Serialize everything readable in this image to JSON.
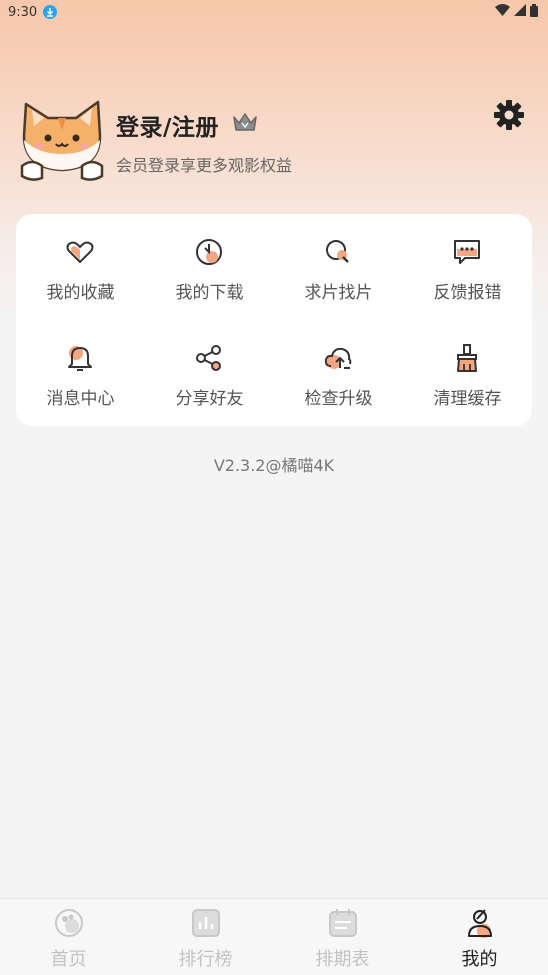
{
  "status": {
    "time": "9:30"
  },
  "profile": {
    "login_label": "登录/注册",
    "subtitle": "会员登录享更多观影权益"
  },
  "features": [
    {
      "label": "我的收藏",
      "icon": "heart-icon"
    },
    {
      "label": "我的下载",
      "icon": "download-icon"
    },
    {
      "label": "求片找片",
      "icon": "search-icon"
    },
    {
      "label": "反馈报错",
      "icon": "feedback-icon"
    },
    {
      "label": "消息中心",
      "icon": "bell-icon"
    },
    {
      "label": "分享好友",
      "icon": "share-icon"
    },
    {
      "label": "检查升级",
      "icon": "cloud-upload-icon"
    },
    {
      "label": "清理缓存",
      "icon": "broom-icon"
    }
  ],
  "version": "V2.3.2@橘喵4K",
  "tabs": [
    {
      "label": "首页",
      "icon": "home-icon",
      "active": false
    },
    {
      "label": "排行榜",
      "icon": "ranking-icon",
      "active": false
    },
    {
      "label": "排期表",
      "icon": "calendar-icon",
      "active": false
    },
    {
      "label": "我的",
      "icon": "profile-icon",
      "active": true
    }
  ],
  "colors": {
    "accent": "#f4a582",
    "gradient_top": "#f6c7aa",
    "background": "#f4f4f4"
  }
}
